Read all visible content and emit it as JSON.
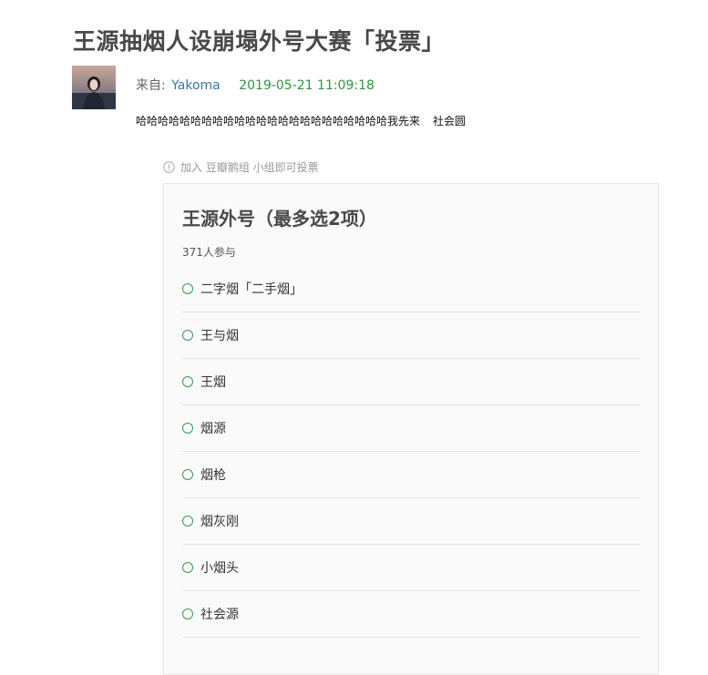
{
  "post": {
    "title": "王源抽烟人设崩塌外号大赛「投票」",
    "from_label": "来自:",
    "author": "Yakoma",
    "date": "2019-05-21 11:09:18",
    "content_main": "哈哈哈哈哈哈哈哈哈哈哈哈哈哈哈哈哈哈哈哈哈哈哈我先来",
    "content_tail": "社会圆"
  },
  "notice": {
    "text": "加入 豆瓣鹅组 小组即可投票",
    "icon": "info-icon"
  },
  "poll": {
    "title": "王源外号（最多选2项）",
    "participants": "371人参与",
    "accent_color": "#3a9a4e",
    "options": [
      {
        "label": "二字烟「二手烟」"
      },
      {
        "label": "王与烟"
      },
      {
        "label": "王烟"
      },
      {
        "label": "烟源"
      },
      {
        "label": "烟枪"
      },
      {
        "label": "烟灰刚"
      },
      {
        "label": "小烟头"
      },
      {
        "label": "社会源"
      }
    ]
  }
}
